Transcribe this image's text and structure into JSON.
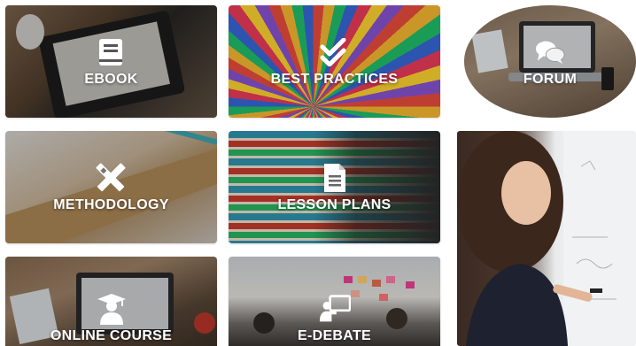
{
  "tiles": {
    "ebook": {
      "label": "EBOOK",
      "icon": "book-icon"
    },
    "best_practices": {
      "label": "BEST PRACTICES",
      "icon": "double-check-icon"
    },
    "forum": {
      "label": "FORUM",
      "icon": "chat-bubbles-icon"
    },
    "methodology": {
      "label": "METHODOLOGY",
      "icon": "pencil-ruler-icon"
    },
    "lesson_plans": {
      "label": "LESSON PLANS",
      "icon": "document-icon"
    },
    "online_course": {
      "label": "ONLINE COURSE",
      "icon": "graduate-user-icon"
    },
    "e_debate": {
      "label": "E-DEBATE",
      "icon": "presenter-board-icon"
    }
  },
  "colors": {
    "label_text": "#ffffff",
    "background": "#ffffff"
  }
}
